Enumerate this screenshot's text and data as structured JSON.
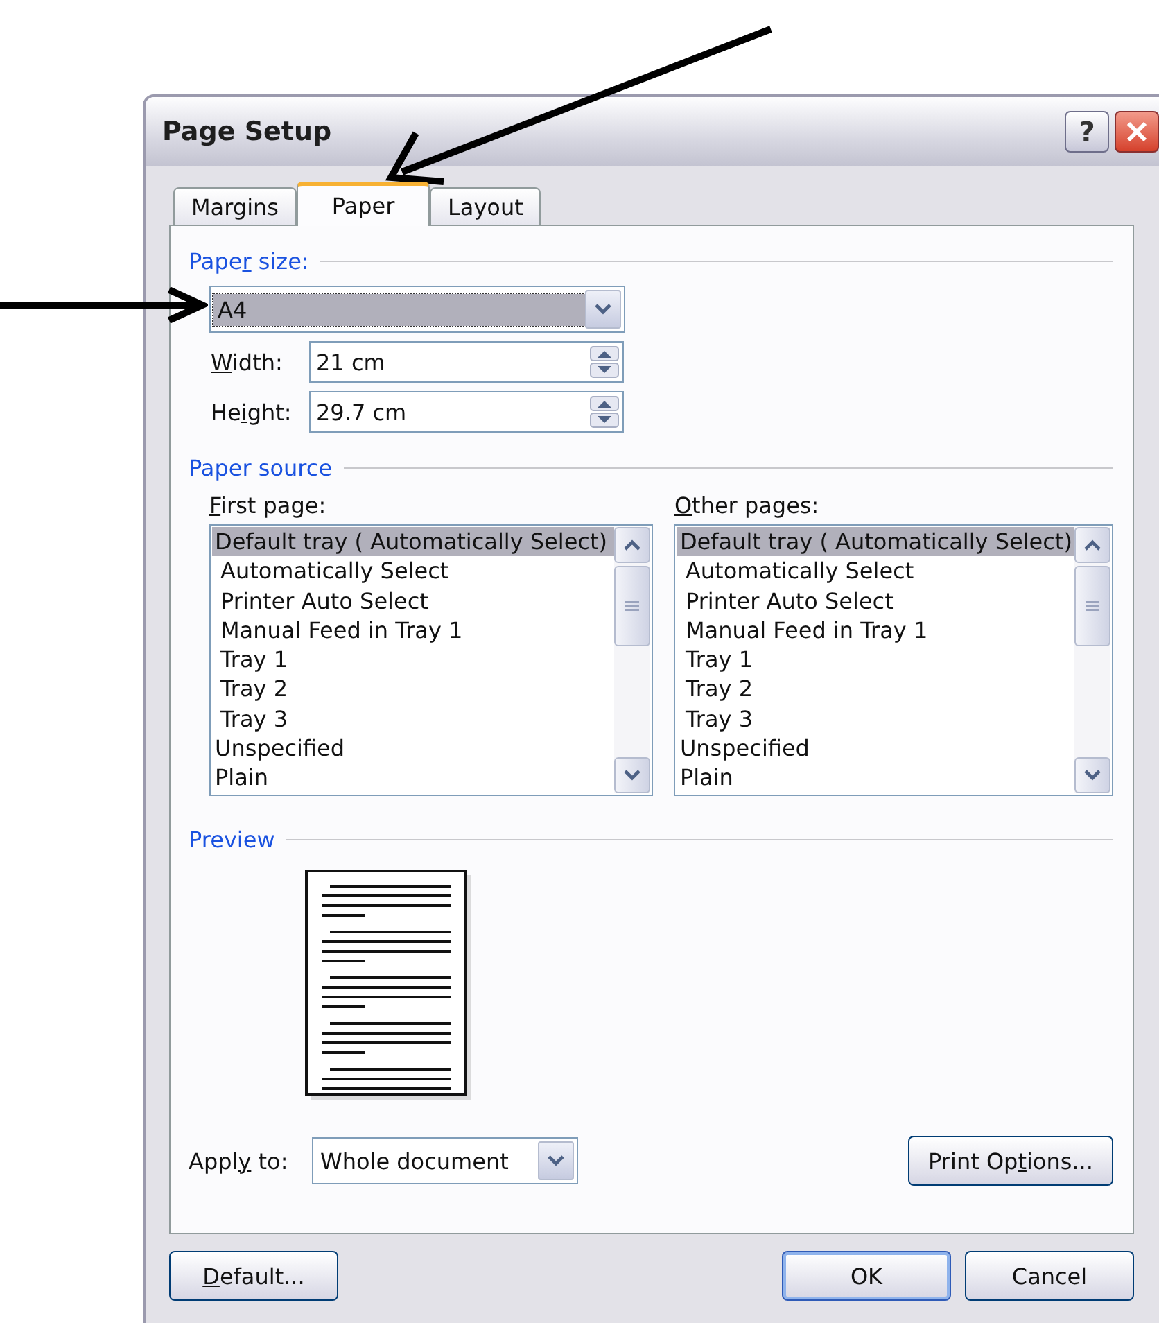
{
  "window": {
    "title": "Page Setup",
    "help": "?"
  },
  "tabs": [
    {
      "label": "Margins",
      "selected": false
    },
    {
      "label": "Paper",
      "selected": true
    },
    {
      "label": "Layout",
      "selected": false
    }
  ],
  "paper_size": {
    "heading": {
      "before": "Pape",
      "key": "r",
      "after": " size:"
    },
    "value": "A4",
    "width": {
      "label": {
        "key": "W",
        "after": "idth:"
      },
      "value": "21 cm"
    },
    "height": {
      "label": {
        "before": "He",
        "key": "i",
        "after": "ght:"
      },
      "value": "29.7 cm"
    }
  },
  "paper_source": {
    "heading": "Paper source",
    "lists": [
      {
        "label": {
          "key": "F",
          "after": "irst page:"
        },
        "items": [
          {
            "text": "Default tray ( Automatically Select)",
            "indented": false,
            "selected": true
          },
          {
            "text": "Automatically Select",
            "indented": true,
            "selected": false
          },
          {
            "text": "Printer Auto Select",
            "indented": true,
            "selected": false
          },
          {
            "text": "Manual Feed in Tray 1",
            "indented": true,
            "selected": false
          },
          {
            "text": "Tray 1",
            "indented": true,
            "selected": false
          },
          {
            "text": "Tray 2",
            "indented": true,
            "selected": false
          },
          {
            "text": "Tray 3",
            "indented": true,
            "selected": false
          },
          {
            "text": "Unspecified",
            "indented": false,
            "selected": false
          },
          {
            "text": "Plain",
            "indented": false,
            "selected": false
          }
        ]
      },
      {
        "label": {
          "key": "O",
          "after": "ther pages:"
        },
        "items": [
          {
            "text": "Default tray ( Automatically Select)",
            "indented": false,
            "selected": true
          },
          {
            "text": "Automatically Select",
            "indented": true,
            "selected": false
          },
          {
            "text": "Printer Auto Select",
            "indented": true,
            "selected": false
          },
          {
            "text": "Manual Feed in Tray 1",
            "indented": true,
            "selected": false
          },
          {
            "text": "Tray 1",
            "indented": true,
            "selected": false
          },
          {
            "text": "Tray 2",
            "indented": true,
            "selected": false
          },
          {
            "text": "Tray 3",
            "indented": true,
            "selected": false
          },
          {
            "text": "Unspecified",
            "indented": false,
            "selected": false
          },
          {
            "text": "Plain",
            "indented": false,
            "selected": false
          }
        ]
      }
    ]
  },
  "preview": {
    "heading": "Preview",
    "apply_to": {
      "label": {
        "before": "Appl",
        "key": "y",
        "after": " to:"
      },
      "value": "Whole document"
    },
    "print_options": {
      "before": "Print Op",
      "key": "t",
      "after": "ions..."
    }
  },
  "buttons": [
    {
      "label": {
        "key": "D",
        "after": "efault..."
      },
      "default": false
    },
    {
      "label": {
        "before": "OK"
      },
      "default": true
    },
    {
      "label": {
        "before": "Cancel"
      },
      "default": false
    }
  ]
}
